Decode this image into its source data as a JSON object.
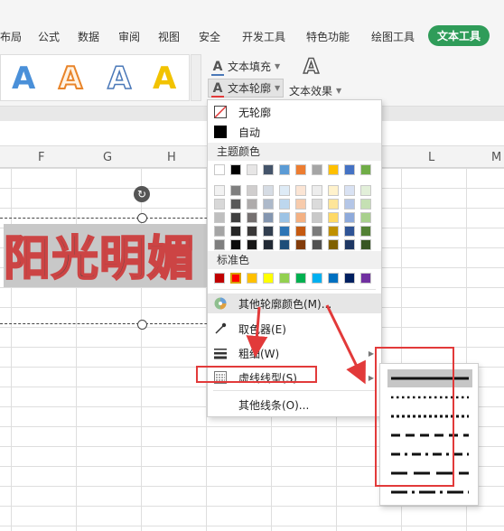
{
  "ribbon_tabs": [
    "布局",
    "公式",
    "数据",
    "审阅",
    "视图",
    "安全",
    "开发工具",
    "特色功能",
    "绘图工具",
    "文本工具"
  ],
  "ribbon": {
    "gallery_letter": "A",
    "text_fill": "文本填充",
    "text_outline": "文本轮廓",
    "text_effect": "文本效果",
    "effect_letter": "A"
  },
  "columns": [
    "F",
    "G",
    "H",
    "L",
    "M"
  ],
  "wordart_text": "阳光明媚",
  "menu": {
    "no_outline": "无轮廓",
    "auto": "自动",
    "theme_colors": "主题颜色",
    "standard_colors": "标准色",
    "more_colors": "其他轮廓颜色(M)...",
    "eyedropper": "取色器(E)",
    "weight": "粗细(W)",
    "dash_type": "虚线线型(S)",
    "more_lines": "其他线条(O)..."
  },
  "theme_palette_top": [
    "#ffffff",
    "#000000",
    "#e7e6e6",
    "#44546a",
    "#5b9bd5",
    "#ed7d31",
    "#a5a5a5",
    "#ffc000",
    "#4472c4",
    "#70ad47"
  ],
  "theme_palette_shades": [
    [
      "#f2f2f2",
      "#7f7f7f",
      "#d0cece",
      "#d6dce4",
      "#deebf6",
      "#fbe5d5",
      "#ededed",
      "#fff2cc",
      "#d9e2f3",
      "#e2efd9"
    ],
    [
      "#d8d8d8",
      "#595959",
      "#aeabab",
      "#adb9ca",
      "#bdd7ee",
      "#f7cbac",
      "#dbdbdb",
      "#fee599",
      "#b4c6e7",
      "#c5e0b3"
    ],
    [
      "#bfbfbf",
      "#3f3f3f",
      "#757070",
      "#8496b0",
      "#9cc3e5",
      "#f4b183",
      "#c9c9c9",
      "#ffd965",
      "#8eaadb",
      "#a8d08d"
    ],
    [
      "#a5a5a5",
      "#262626",
      "#3a3838",
      "#323f4f",
      "#2e75b5",
      "#c55a11",
      "#7b7b7b",
      "#bf9000",
      "#2f5496",
      "#538135"
    ],
    [
      "#7f7f7f",
      "#0c0c0c",
      "#171616",
      "#222a35",
      "#1e4e79",
      "#833c0b",
      "#525252",
      "#7f6000",
      "#1f3864",
      "#375623"
    ]
  ],
  "standard_palette": [
    "#c00000",
    "#ff0000",
    "#ffc000",
    "#ffff00",
    "#92d050",
    "#00b050",
    "#00b0f0",
    "#0070c0",
    "#002060",
    "#7030a0"
  ],
  "dash_styles": [
    "solid",
    "round-dot",
    "square-dot",
    "dash",
    "dash-dot",
    "long-dash",
    "long-dash-dot"
  ],
  "colors": {
    "accent_green": "#2f9c59",
    "annotation_red": "#e23a3a",
    "outline_red": "#cc4444"
  }
}
